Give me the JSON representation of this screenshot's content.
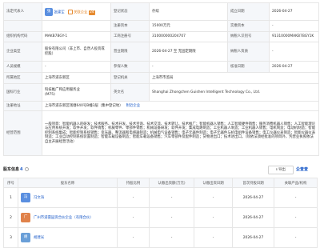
{
  "info": {
    "legal_rep_label": "法定代表人",
    "legal_rep_name": "张建军",
    "legal_rep_avatar": "张",
    "related_label": "关联企业",
    "related_count": "24",
    "reg_status_label": "登记状态",
    "reg_status": "存续",
    "est_date_label": "成立日期",
    "est_date": "2026-04-27",
    "reg_capital_label": "注册资本",
    "reg_capital": "15000万元",
    "paid_capital_label": "实缴资本",
    "paid_capital": "-",
    "org_code_label": "组织机构代码",
    "org_code": "MAKB7BGY-1",
    "biz_reg_no_label": "工商注册号",
    "biz_reg_no": "310000000204707",
    "taxpayer_id_label": "纳税人识别号",
    "taxpayer_id": "91310000MAKB7BGY1K",
    "company_type_label": "企业类型",
    "company_type": "股份有限公司（非上市、自然人投资或控股）",
    "term_label": "营业期限",
    "term": "2026-04-27 至 无固定期限",
    "taxpayer_qual_label": "纳税人资质",
    "taxpayer_qual": "-",
    "staff_label": "人员规模",
    "staff": "-",
    "insured_label": "参保人数",
    "insured": "-",
    "approve_date_label": "核准日期",
    "approve_date": "2026-04-27",
    "region_label": "所属地区",
    "region": "上海市浦东新区",
    "authority_label": "登记机关",
    "authority": "上海市市监局",
    "industry_label": "国标行业",
    "industry_l1": "科技推广和应用服务业",
    "industry_l2": "(M75)",
    "eng_name_label": "英文名",
    "eng_name": "Shanghai Zhongchen Guishen Intelligent Technology Co., Ltd.",
    "address_label": "注册地址",
    "address": "上海市浦东新区钱塘640号B幢3层（集中登记地）",
    "address_link": "附近企业",
    "scope_label": "经营范围",
    "scope": "一般项目：智能机器人的研发；技术服务、技术开发、技术咨询、技术交流、技术转让、技术推广；智能机器人销售；人工智能硬件销售；服务消费机器人销售；人工智能理论与应用系统开发；软件开发；软件销售；机械零件、零部件销售；机械设备研发；软件开发；集成电路制造；工业机器人制造；工业机器人销售；电机制造；电动机制造；智能控制系统集成；智能控制系统销售；变压器、整流器和电感器制造；机械电气设备销售；电子元器件制造；电子元器件与机电组件设备销售；电工仪器仪表制造；智能仪器仪表制造；工业自动控制系统装置制造；智能车载设备制造；智能车载设备销售；汽车零部件及配件制造；货物进出口；技术进出口。（除依法须经批准的项目外，凭营业执照依法自主开展经营活动）"
  },
  "shareholders": {
    "title": "股东信息",
    "count": "4",
    "export_label": "导出",
    "brand": "企查查",
    "columns": [
      "序号",
      "股东名称",
      "持股比例",
      "认缴出资额(万元)",
      "认缴出资日期",
      "首次持股日期",
      "关联产品/机构"
    ],
    "rows": [
      {
        "index": "1",
        "avatar": "冯",
        "avatar_color": "#5a8fe0",
        "name": "冯文海",
        "ratio": "-",
        "amount": "-",
        "date": "-",
        "first": "2026-04-27",
        "product": "-"
      },
      {
        "index": "2",
        "avatar": "广",
        "avatar_color": "#e0824a",
        "name": "广州市浦雷园资合伙企业（有限合伙）",
        "ratio": "-",
        "amount": "-",
        "date": "-",
        "first": "2026-04-27",
        "product": "-"
      },
      {
        "index": "3",
        "avatar": "胡",
        "avatar_color": "#6a9fd8",
        "name": "胡建光",
        "ratio": "-",
        "amount": "-",
        "date": "-",
        "first": "2026-04-27",
        "product": "-"
      }
    ],
    "detail_link": "股权穿透"
  },
  "colors": {
    "link": "#1a5ac8",
    "accent": "#e68a2e",
    "label_bg": "#f5f7fa"
  }
}
